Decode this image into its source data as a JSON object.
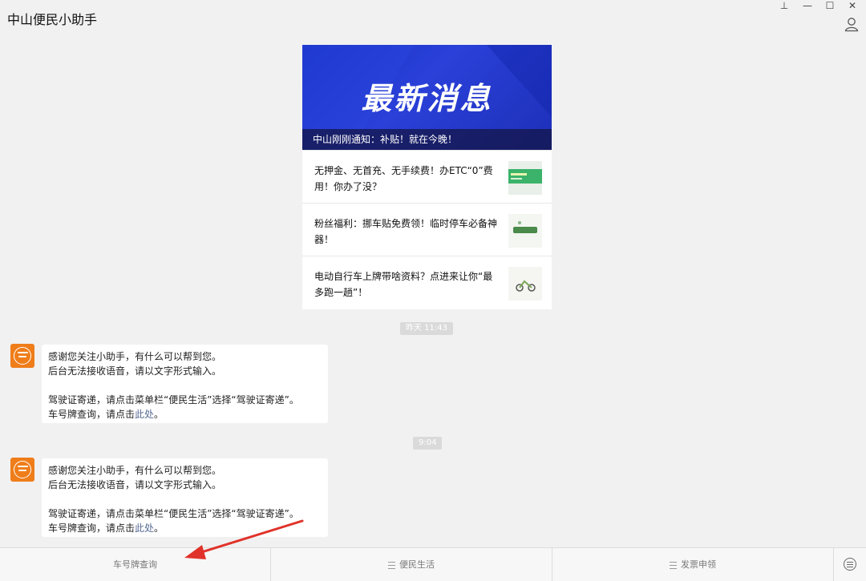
{
  "window": {
    "title": "中山便民小助手",
    "controls": {
      "pin": "⊥",
      "minimize": "—",
      "maximize": "☐",
      "close": "✕"
    }
  },
  "card": {
    "hero_text": "最新消息",
    "hero_caption": "中山刚刚通知：补贴！就在今晚！",
    "articles": [
      {
        "line1": "无押金、无首充、无手续费！办ETC“0”费",
        "line2": "用！你办了没？"
      },
      {
        "line1": "粉丝福利：挪车贴免费领！临时停车必备神",
        "line2": "器！"
      },
      {
        "line1": "电动自行车上牌带啥资料？点进来让你“最",
        "line2": "多跑一趟”！"
      }
    ]
  },
  "times": [
    "昨天 11:43",
    "9:04"
  ],
  "messages": [
    {
      "line1": "感谢您关注小助手，有什么可以帮到您。",
      "line2": "后台无法接收语音，请以文字形式输入。",
      "line3": "驾驶证寄递，请点击菜单栏“便民生活”选择“驾驶证寄递”。",
      "line4_prefix": "车号牌查询，请点击",
      "line4_link": "此处",
      "line4_suffix": "。"
    },
    {
      "line1": "感谢您关注小助手，有什么可以帮到您。",
      "line2": "后台无法接收语音，请以文字形式输入。",
      "line3": "驾驶证寄递，请点击菜单栏“便民生活”选择“驾驶证寄递”。",
      "line4_prefix": "车号牌查询，请点击",
      "line4_link": "此处",
      "line4_suffix": "。"
    }
  ],
  "menu": {
    "item1": "车号牌查询",
    "item2": "便民生活",
    "item3": "发票申领"
  },
  "colors": {
    "hero_blue": "#1f35c9",
    "accent_orange": "#ef7d1a",
    "arrow_red": "#e0322a",
    "link": "#576b95"
  }
}
